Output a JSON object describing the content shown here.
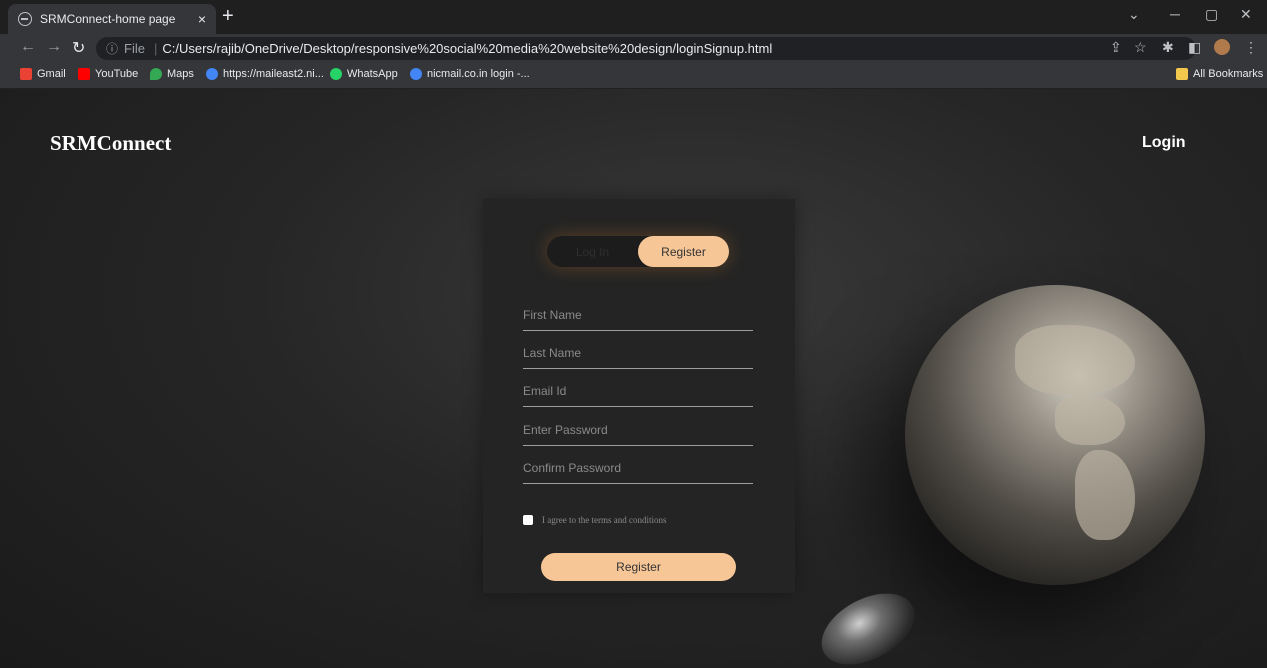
{
  "browser": {
    "tab_title": "SRMConnect-home page",
    "tab_close": "×",
    "new_tab": "+",
    "url_scheme": "File",
    "url_path": "C:/Users/rajib/OneDrive/Desktop/responsive%20social%20media%20website%20design/loginSignup.html",
    "bookmarks": [
      {
        "label": "Gmail",
        "color": "#ea4335"
      },
      {
        "label": "YouTube",
        "color": "#ff0000"
      },
      {
        "label": "Maps",
        "color": "#34a853"
      },
      {
        "label": "https://maileast2.ni...",
        "color": "#4285f4"
      },
      {
        "label": "WhatsApp",
        "color": "#25d366"
      },
      {
        "label": "nicmail.co.in login -...",
        "color": "#4285f4"
      }
    ],
    "all_bookmarks": "All Bookmarks"
  },
  "site": {
    "brand": "SRMConnect",
    "nav_login": "Login"
  },
  "form": {
    "toggle_login": "Log In",
    "toggle_register": "Register",
    "fields": {
      "first_name": "First Name",
      "last_name": "Last Name",
      "email": "Email Id",
      "password": "Enter Password",
      "confirm_password": "Confirm Password"
    },
    "terms_label": "I agree to the terms and conditions",
    "submit_label": "Register"
  },
  "colors": {
    "accent": "#f6c697",
    "card_bg": "#242424"
  }
}
